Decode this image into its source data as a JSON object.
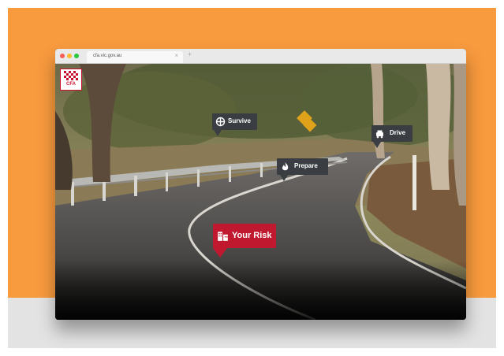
{
  "browser": {
    "tab_title": "cfa.vic.gov.au",
    "close_symbol": "×",
    "new_tab_symbol": "+"
  },
  "logo": {
    "text": "CFA",
    "icon": "cfa-checker-logo-icon"
  },
  "hotspots": {
    "survive": {
      "label": "Survive",
      "icon": "compass-icon"
    },
    "drive": {
      "label": "Drive",
      "icon": "car-icon"
    },
    "prepare": {
      "label": "Prepare",
      "icon": "flame-icon"
    },
    "your_risk": {
      "label": "Your Risk",
      "icon": "building-icon"
    }
  },
  "colors": {
    "background": "#f89a3e",
    "floor": "#e3e3e3",
    "pin_dark": "#3a3e42",
    "pin_risk": "#c0182e",
    "brand": "#c8102e"
  }
}
